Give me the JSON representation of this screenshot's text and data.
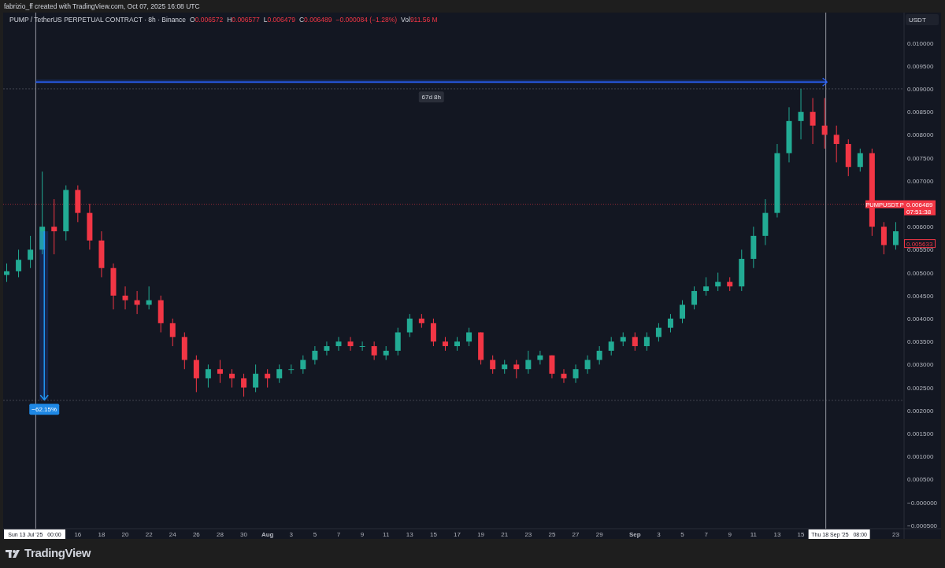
{
  "header": {
    "text": "fabrizio_ff created with TradingView.com, Oct 07, 2025 16:08 UTC"
  },
  "legend": {
    "symbol": "PUMP / TetherUS PERPETUAL CONTRACT · 8h · Binance",
    "ohlc": [
      {
        "key": "O",
        "value": "0.006572"
      },
      {
        "key": "H",
        "value": "0.006577"
      },
      {
        "key": "L",
        "value": "0.006479"
      },
      {
        "key": "C",
        "value": "0.006489"
      }
    ],
    "change": "−0.000084 (−1.28%)",
    "volume_key": "Vol",
    "volume": "911.56 M"
  },
  "currency_button": "USDT",
  "chart": {
    "chart_data": {
      "type": "candlestick",
      "ylim": [
        -0.000572,
        0.01066
      ],
      "categories": [
        null,
        null,
        null,
        null,
        null,
        null,
        "16",
        null,
        "18",
        null,
        "20",
        null,
        "22",
        null,
        "24",
        null,
        "26",
        null,
        "28",
        null,
        "30",
        null,
        "Aug",
        null,
        "3",
        null,
        "5",
        null,
        "7",
        null,
        "9",
        null,
        "11",
        null,
        "13",
        null,
        "15",
        null,
        "17",
        null,
        "19",
        null,
        "21",
        null,
        "23",
        null,
        "25",
        null,
        "27",
        null,
        "29",
        null,
        null,
        "Sep",
        null,
        "3",
        null,
        "5",
        null,
        "7",
        null,
        "9",
        null,
        "11",
        null,
        "13",
        null,
        "15",
        null,
        null,
        null,
        null,
        null,
        null,
        null,
        "23"
      ],
      "ohlc": [
        [
          0.00495,
          0.0052,
          0.0048,
          0.00503
        ],
        [
          0.00503,
          0.0055,
          0.0049,
          0.00528
        ],
        [
          0.00528,
          0.0058,
          0.0051,
          0.0055
        ],
        [
          0.0055,
          0.0072,
          0.0054,
          0.006
        ],
        [
          0.006,
          0.0066,
          0.0054,
          0.0059
        ],
        [
          0.0059,
          0.0069,
          0.0057,
          0.0068
        ],
        [
          0.0068,
          0.0069,
          0.0061,
          0.0063
        ],
        [
          0.0063,
          0.0065,
          0.0055,
          0.0057
        ],
        [
          0.0057,
          0.0059,
          0.0049,
          0.0051
        ],
        [
          0.0051,
          0.0052,
          0.0042,
          0.0045
        ],
        [
          0.0045,
          0.0047,
          0.0042,
          0.0044
        ],
        [
          0.0044,
          0.0046,
          0.0041,
          0.0043
        ],
        [
          0.0043,
          0.0047,
          0.0042,
          0.0044
        ],
        [
          0.0044,
          0.0045,
          0.0037,
          0.0039
        ],
        [
          0.0039,
          0.004,
          0.0034,
          0.0036
        ],
        [
          0.0036,
          0.0037,
          0.0029,
          0.0031
        ],
        [
          0.0031,
          0.0032,
          0.0024,
          0.0027
        ],
        [
          0.0027,
          0.003,
          0.0025,
          0.0029
        ],
        [
          0.0029,
          0.0031,
          0.0026,
          0.0028
        ],
        [
          0.0028,
          0.0029,
          0.0025,
          0.0027
        ],
        [
          0.0027,
          0.0028,
          0.0023,
          0.0025
        ],
        [
          0.0025,
          0.003,
          0.0024,
          0.0028
        ],
        [
          0.0028,
          0.0029,
          0.0025,
          0.0027
        ],
        [
          0.0027,
          0.003,
          0.0026,
          0.0029
        ],
        [
          0.0029,
          0.003,
          0.0028,
          0.0029
        ],
        [
          0.0029,
          0.0032,
          0.0028,
          0.0031
        ],
        [
          0.0031,
          0.0034,
          0.003,
          0.0033
        ],
        [
          0.0033,
          0.0035,
          0.0032,
          0.0034
        ],
        [
          0.0034,
          0.0036,
          0.0033,
          0.0035
        ],
        [
          0.0035,
          0.0036,
          0.0033,
          0.0034
        ],
        [
          0.0034,
          0.0035,
          0.0033,
          0.0034
        ],
        [
          0.0034,
          0.0035,
          0.0031,
          0.0032
        ],
        [
          0.0032,
          0.0034,
          0.0031,
          0.0033
        ],
        [
          0.0033,
          0.0038,
          0.0032,
          0.0037
        ],
        [
          0.0037,
          0.0041,
          0.0036,
          0.004
        ],
        [
          0.004,
          0.0041,
          0.0038,
          0.0039
        ],
        [
          0.0039,
          0.004,
          0.0034,
          0.0035
        ],
        [
          0.0035,
          0.0036,
          0.0033,
          0.0034
        ],
        [
          0.0034,
          0.0036,
          0.0033,
          0.0035
        ],
        [
          0.0035,
          0.0038,
          0.0034,
          0.0037
        ],
        [
          0.0037,
          0.0037,
          0.003,
          0.0031
        ],
        [
          0.0031,
          0.0032,
          0.0028,
          0.0029
        ],
        [
          0.0029,
          0.0031,
          0.0028,
          0.003
        ],
        [
          0.003,
          0.0031,
          0.0027,
          0.0029
        ],
        [
          0.0029,
          0.0033,
          0.0028,
          0.0031
        ],
        [
          0.0031,
          0.0033,
          0.003,
          0.0032
        ],
        [
          0.0032,
          0.0032,
          0.0027,
          0.0028
        ],
        [
          0.0028,
          0.0029,
          0.0026,
          0.0027
        ],
        [
          0.0027,
          0.003,
          0.0026,
          0.0029
        ],
        [
          0.0029,
          0.0032,
          0.0028,
          0.0031
        ],
        [
          0.0031,
          0.0034,
          0.003,
          0.0033
        ],
        [
          0.0033,
          0.0036,
          0.0032,
          0.0035
        ],
        [
          0.0035,
          0.0037,
          0.0034,
          0.0036
        ],
        [
          0.0036,
          0.0037,
          0.0033,
          0.0034
        ],
        [
          0.0034,
          0.0037,
          0.0033,
          0.0036
        ],
        [
          0.0036,
          0.0039,
          0.0035,
          0.0038
        ],
        [
          0.0038,
          0.0041,
          0.0037,
          0.004
        ],
        [
          0.004,
          0.0044,
          0.0039,
          0.0043
        ],
        [
          0.0043,
          0.0047,
          0.0042,
          0.0046
        ],
        [
          0.0046,
          0.0049,
          0.0045,
          0.0047
        ],
        [
          0.0047,
          0.005,
          0.0046,
          0.0048
        ],
        [
          0.0048,
          0.0049,
          0.0046,
          0.0047
        ],
        [
          0.0047,
          0.0055,
          0.0046,
          0.0053
        ],
        [
          0.0053,
          0.006,
          0.0051,
          0.0058
        ],
        [
          0.0058,
          0.0066,
          0.0056,
          0.0063
        ],
        [
          0.0063,
          0.0078,
          0.0062,
          0.0076
        ],
        [
          0.0076,
          0.0086,
          0.0074,
          0.0083
        ],
        [
          0.0083,
          0.009,
          0.0079,
          0.0085
        ],
        [
          0.0085,
          0.0088,
          0.0078,
          0.0082
        ],
        [
          0.0082,
          0.0088,
          0.0077,
          0.008
        ],
        [
          0.008,
          0.0082,
          0.0074,
          0.0078
        ],
        [
          0.0078,
          0.0079,
          0.0071,
          0.0073
        ],
        [
          0.0073,
          0.0077,
          0.0072,
          0.0076
        ],
        [
          0.0076,
          0.0077,
          0.0058,
          0.006
        ],
        [
          0.006,
          0.0061,
          0.0054,
          0.0056
        ],
        [
          0.0056,
          0.0061,
          0.0055,
          0.0059
        ]
      ],
      "ref_lines": [
        {
          "axis": "y",
          "value": 0.006489,
          "label": "0.006489"
        },
        {
          "axis": "y",
          "value": 0.009
        },
        {
          "axis": "y",
          "value": 0.00222
        }
      ],
      "yticks": [
        {
          "value": 0.01,
          "label": "0.010000"
        },
        {
          "value": 0.0095,
          "label": "0.009500"
        },
        {
          "value": 0.009,
          "label": "0.009000"
        },
        {
          "value": 0.0085,
          "label": "0.008500"
        },
        {
          "value": 0.008,
          "label": "0.008000"
        },
        {
          "value": 0.0075,
          "label": "0.007500"
        },
        {
          "value": 0.007,
          "label": "0.007000"
        },
        {
          "value": 0.006,
          "label": "0.006000"
        },
        {
          "value": 0.0055,
          "label": "0.005500"
        },
        {
          "value": 0.005,
          "label": "0.005000"
        },
        {
          "value": 0.0045,
          "label": "0.004500"
        },
        {
          "value": 0.004,
          "label": "0.004000"
        },
        {
          "value": 0.0035,
          "label": "0.003500"
        },
        {
          "value": 0.003,
          "label": "0.003000"
        },
        {
          "value": 0.0025,
          "label": "0.002500"
        },
        {
          "value": 0.002,
          "label": "0.002000"
        },
        {
          "value": 0.0015,
          "label": "0.001500"
        },
        {
          "value": 0.001,
          "label": "0.001000"
        },
        {
          "value": 0.0005,
          "label": "0.000500"
        },
        {
          "value": 0,
          "label": "−0.000000"
        },
        {
          "value": -0.0005,
          "label": "−0.000500"
        }
      ],
      "orientation": "vertical"
    },
    "range_duration": "67d 8h",
    "range_change": "−62.15%",
    "crosshair_dates": [
      "Sun 13 Jul '25   00:00",
      "Thu 18 Sep '25   08:00"
    ],
    "symbol_tag": "PUMPUSDT.P",
    "countdown": "07:51:38",
    "marker_price": "0.005633"
  },
  "footer": {
    "logo_text": "TradingView"
  }
}
